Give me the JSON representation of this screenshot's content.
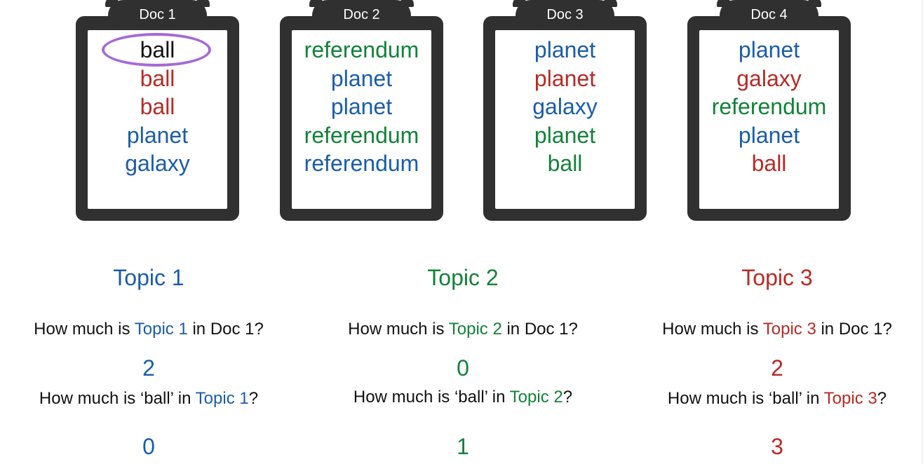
{
  "colors": {
    "topic1": "#1a5da8",
    "topic2": "#128238",
    "topic3": "#b52b24",
    "plain": "#111111",
    "highlight_circle": "#a46ad5"
  },
  "docs": [
    {
      "label": "Doc 1",
      "words": [
        {
          "text": "ball",
          "topic": "plain",
          "circled": true
        },
        {
          "text": "ball",
          "topic": "topic3"
        },
        {
          "text": "ball",
          "topic": "topic3"
        },
        {
          "text": "planet",
          "topic": "topic1"
        },
        {
          "text": "galaxy",
          "topic": "topic1"
        }
      ]
    },
    {
      "label": "Doc 2",
      "words": [
        {
          "text": "referendum",
          "topic": "topic2"
        },
        {
          "text": "planet",
          "topic": "topic1"
        },
        {
          "text": "planet",
          "topic": "topic1"
        },
        {
          "text": "referendum",
          "topic": "topic2"
        },
        {
          "text": "referendum",
          "topic": "topic1"
        }
      ]
    },
    {
      "label": "Doc 3",
      "words": [
        {
          "text": "planet",
          "topic": "topic1"
        },
        {
          "text": "planet",
          "topic": "topic3"
        },
        {
          "text": "galaxy",
          "topic": "topic1"
        },
        {
          "text": "planet",
          "topic": "topic2"
        },
        {
          "text": "ball",
          "topic": "topic2"
        }
      ]
    },
    {
      "label": "Doc 4",
      "words": [
        {
          "text": "planet",
          "topic": "topic1"
        },
        {
          "text": "galaxy",
          "topic": "topic3"
        },
        {
          "text": "referendum",
          "topic": "topic2"
        },
        {
          "text": "planet",
          "topic": "topic1"
        },
        {
          "text": "ball",
          "topic": "topic3"
        }
      ]
    }
  ],
  "topics": [
    {
      "title": "Topic 1",
      "color_key": "topic1",
      "q1": {
        "pre": "How much is ",
        "hl": "Topic 1",
        "post": " in Doc 1?"
      },
      "a1": "2",
      "q2": {
        "pre": "How much is ‘ball’ in ",
        "hl": "Topic 1",
        "post": "?"
      },
      "a2": "0"
    },
    {
      "title": "Topic 2",
      "color_key": "topic2",
      "q1": {
        "pre": "How much is ",
        "hl": "Topic 2",
        "post": " in Doc 1?"
      },
      "a1": "0",
      "q2": {
        "pre": "How much is ‘ball’ in ",
        "hl": "Topic 2",
        "post": "?"
      },
      "a2": "1"
    },
    {
      "title": "Topic 3",
      "color_key": "topic3",
      "q1": {
        "pre": "How much is ",
        "hl": "Topic 3",
        "post": " in Doc 1?"
      },
      "a1": "2",
      "q2": {
        "pre": "How much is ‘ball’ in ",
        "hl": "Topic 3",
        "post": "?"
      },
      "a2": "3"
    }
  ]
}
